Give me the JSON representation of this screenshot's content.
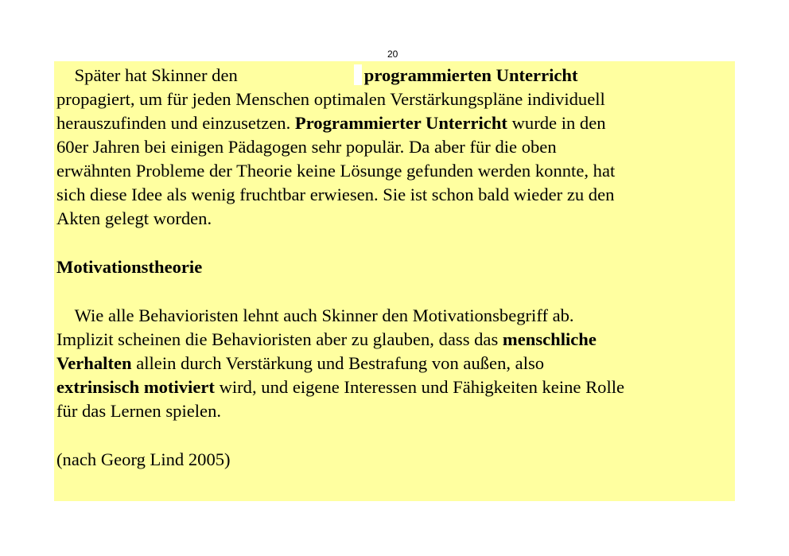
{
  "page_number": "20",
  "highlight_color": "#ffffa0",
  "para1": {
    "l1_a": "Später hat Skinner den",
    "l1_b": "programmierten Unterricht",
    "l2": "propagiert, um für jeden Menschen optimalen Verstärkungspläne individuell",
    "l3_a": "herauszufinden und einzusetzen.",
    "l3_b": "Programmierter Unterricht",
    "l3_c": "wurde in den",
    "l4": "60er Jahren bei einigen Pädagogen sehr populär. Da aber für die oben",
    "l5": "erwähnten Probleme der Theorie keine Lösunge gefunden werden konnte, hat",
    "l6": "sich diese Idee als wenig fruchtbar erwiesen. Sie ist schon bald wieder zu den",
    "l7": "Akten gelegt worden."
  },
  "heading": "Motivationstheorie",
  "para2": {
    "l1": "Wie alle Behavioristen lehnt auch Skinner den Motivationsbegriff ab.",
    "l2_a": "Implizit scheinen die Behavioristen aber zu glauben, dass das",
    "l2_b": "menschliche",
    "l3_a": "Verhalten",
    "l3_b": "allein durch Verstärkung und Bestrafung von außen, also",
    "l4_a": "extrinsisch motiviert",
    "l4_b": "wird, und eigene Interessen und Fähigkeiten keine Rolle",
    "l5": "für das Lernen spielen."
  },
  "citation": "(nach Georg Lind 2005)"
}
